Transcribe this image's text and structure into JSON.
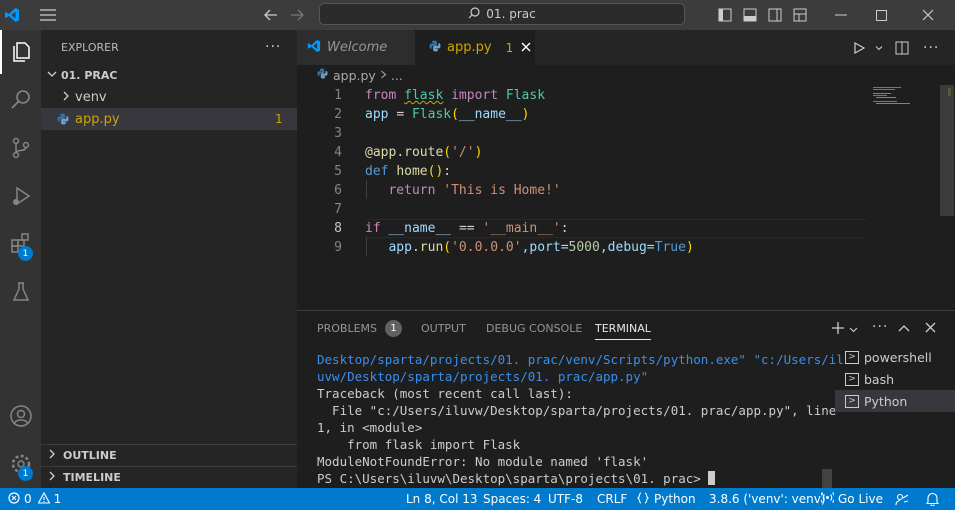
{
  "titlebar": {
    "search_text": "01. prac"
  },
  "activity": {
    "extensions_badge": "1",
    "manage_badge": "1"
  },
  "sidebar": {
    "title": "EXPLORER",
    "more": "···",
    "folder": "01. PRAC",
    "items": [
      {
        "label": "venv"
      },
      {
        "label": "app.py",
        "badge": "1"
      }
    ],
    "outline": "OUTLINE",
    "timeline": "TIMELINE"
  },
  "tabs": [
    {
      "label": "Welcome"
    },
    {
      "label": "app.py",
      "badge": "1"
    }
  ],
  "breadcrumb": {
    "file": "app.py",
    "rest": "..."
  },
  "editor": {
    "line_numbers": [
      "1",
      "2",
      "3",
      "4",
      "5",
      "6",
      "7",
      "8",
      "9"
    ],
    "tokens": {
      "l1": [
        "from",
        "flask",
        "import",
        "Flask"
      ],
      "l2": [
        "app",
        "=",
        "Flask",
        "(",
        "__name__",
        ")"
      ],
      "l4": [
        "@app",
        ".route",
        "(",
        "'/'",
        ")"
      ],
      "l5": [
        "def",
        "home",
        "()",
        ":"
      ],
      "l6": [
        "return",
        "'This is Home!'"
      ],
      "l8": [
        "if",
        "__name__",
        "==",
        "'__main__'",
        ":"
      ],
      "l9": [
        "app",
        ".run",
        "(",
        "'0.0.0.0'",
        ",port=",
        "5000",
        ",debug=",
        "True",
        ")"
      ]
    }
  },
  "panel": {
    "tabs": [
      "PROBLEMS",
      "OUTPUT",
      "DEBUG CONSOLE",
      "TERMINAL"
    ],
    "problems_count": "1",
    "terminal_lines": [
      "Desktop/sparta/projects/01. prac/venv/Scripts/python.exe\" \"c:/Users/il",
      "uvw/Desktop/sparta/projects/01. prac/app.py\"",
      "Traceback (most recent call last):",
      "  File \"c:/Users/iluvw/Desktop/sparta/projects/01. prac/app.py\", line",
      "1, in <module>",
      "    from flask import Flask",
      "ModuleNotFoundError: No module named 'flask'",
      "PS C:\\Users\\iluvw\\Desktop\\sparta\\projects\\01. prac> "
    ],
    "shells": [
      "powershell",
      "bash",
      "Python"
    ]
  },
  "status": {
    "errors": "0",
    "warnings": "1",
    "position": "Ln 8, Col 13",
    "spaces": "Spaces: 4",
    "encoding": "UTF-8",
    "eol": "CRLF",
    "language": "Python",
    "interpreter": "3.8.6 ('venv': venv)",
    "golive": "Go Live"
  },
  "colors": {
    "accent": "#007acc",
    "warning": "#cca700"
  }
}
